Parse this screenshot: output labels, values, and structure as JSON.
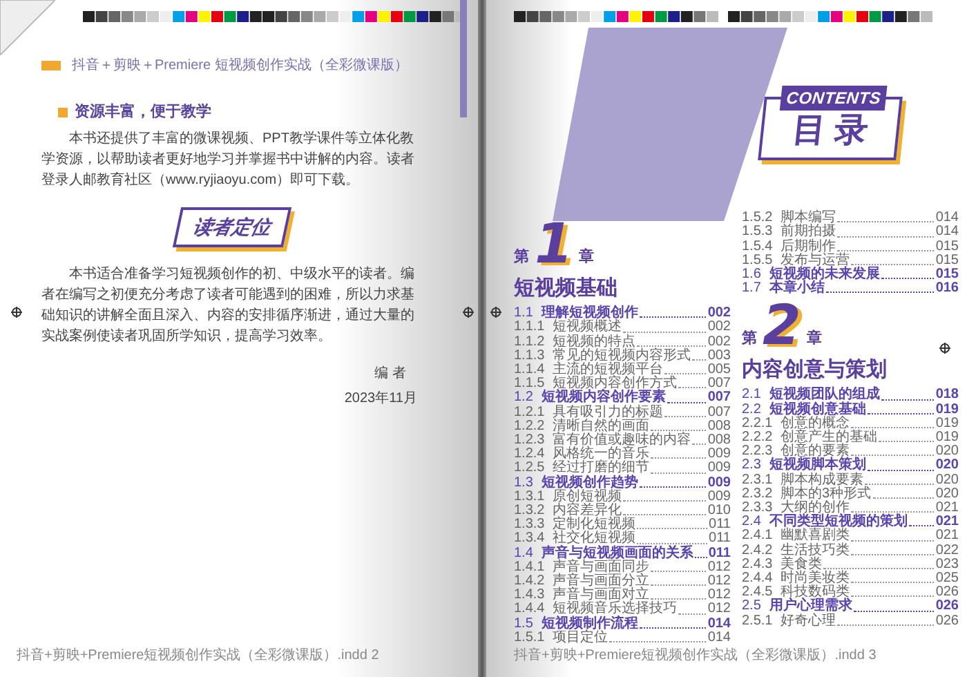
{
  "left_page": {
    "running_head": "抖音＋剪映＋Premiere 短视频创作实战（全彩微课版）",
    "section_heading": "资源丰富，便于教学",
    "section_text": "本书还提供了丰富的微课视频、PPT教学课件等立体化教学资源，以帮助读者更好地学习并掌握书中讲解的内容。读者登录人邮教育社区（www.ryjiaoyu.com）即可下载。",
    "badge": "读者定位",
    "body_text": "本书适合准备学习短视频创作的初、中级水平的读者。编者在编写之初便充分考虑了读者可能遇到的困难，所以力求基础知识的讲解全面且深入、内容的安排循序渐进，通过大量的实战案例使读者巩固所学知识，提高学习效率。",
    "signature": "编 者",
    "date": "2023年11月",
    "slug": "抖音+剪映+Premiere短视频创作实战（全彩微课版）.indd 2"
  },
  "right_page": {
    "contents_label": "CONTENTS",
    "contents_title": "目 录",
    "columns": [
      [
        {
          "kind": "chapter",
          "prefix": "第",
          "number": "1",
          "suffix": "章",
          "title": "短视频基础"
        },
        {
          "kind": "section",
          "number": "1.1",
          "title": "理解短视频创作",
          "page": "002"
        },
        {
          "kind": "subsection",
          "number": "1.1.1",
          "title": "短视频概述",
          "page": "002"
        },
        {
          "kind": "subsection",
          "number": "1.1.2",
          "title": "短视频的特点",
          "page": "002"
        },
        {
          "kind": "subsection",
          "number": "1.1.3",
          "title": "常见的短视频内容形式",
          "page": "003"
        },
        {
          "kind": "subsection",
          "number": "1.1.4",
          "title": "主流的短视频平台",
          "page": "005"
        },
        {
          "kind": "subsection",
          "number": "1.1.5",
          "title": "短视频内容创作方式",
          "page": "007"
        },
        {
          "kind": "section",
          "number": "1.2",
          "title": "短视频内容创作要素",
          "page": "007"
        },
        {
          "kind": "subsection",
          "number": "1.2.1",
          "title": "具有吸引力的标题",
          "page": "007"
        },
        {
          "kind": "subsection",
          "number": "1.2.2",
          "title": "清晰自然的画面",
          "page": "008"
        },
        {
          "kind": "subsection",
          "number": "1.2.3",
          "title": "富有价值或趣味的内容",
          "page": "008"
        },
        {
          "kind": "subsection",
          "number": "1.2.4",
          "title": "风格统一的音乐",
          "page": "009"
        },
        {
          "kind": "subsection",
          "number": "1.2.5",
          "title": "经过打磨的细节",
          "page": "009"
        },
        {
          "kind": "section",
          "number": "1.3",
          "title": "短视频创作趋势",
          "page": "009"
        },
        {
          "kind": "subsection",
          "number": "1.3.1",
          "title": "原创短视频",
          "page": "009"
        },
        {
          "kind": "subsection",
          "number": "1.3.2",
          "title": "内容差异化",
          "page": "010"
        },
        {
          "kind": "subsection",
          "number": "1.3.3",
          "title": "定制化短视频",
          "page": "011"
        },
        {
          "kind": "subsection",
          "number": "1.3.4",
          "title": "社交化短视频",
          "page": "011"
        },
        {
          "kind": "section",
          "number": "1.4",
          "title": "声音与短视频画面的关系",
          "page": "011"
        },
        {
          "kind": "subsection",
          "number": "1.4.1",
          "title": "声音与画面同步",
          "page": "012"
        },
        {
          "kind": "subsection",
          "number": "1.4.2",
          "title": "声音与画面分立",
          "page": "012"
        },
        {
          "kind": "subsection",
          "number": "1.4.3",
          "title": "声音与画面对立",
          "page": "012"
        },
        {
          "kind": "subsection",
          "number": "1.4.4",
          "title": "短视频音乐选择技巧",
          "page": "012"
        },
        {
          "kind": "section",
          "number": "1.5",
          "title": "短视频制作流程",
          "page": "014"
        },
        {
          "kind": "subsection",
          "number": "1.5.1",
          "title": "项目定位",
          "page": "014"
        }
      ],
      [
        {
          "kind": "subsection",
          "number": "1.5.2",
          "title": "脚本编写",
          "page": "014"
        },
        {
          "kind": "subsection",
          "number": "1.5.3",
          "title": "前期拍摄",
          "page": "014"
        },
        {
          "kind": "subsection",
          "number": "1.5.4",
          "title": "后期制作",
          "page": "015"
        },
        {
          "kind": "subsection",
          "number": "1.5.5",
          "title": "发布与运营",
          "page": "015"
        },
        {
          "kind": "section",
          "number": "1.6",
          "title": "短视频的未来发展",
          "page": "015"
        },
        {
          "kind": "section",
          "number": "1.7",
          "title": "本章小结",
          "page": "016"
        },
        {
          "kind": "chapter",
          "prefix": "第",
          "number": "2",
          "suffix": "章",
          "title": "内容创意与策划"
        },
        {
          "kind": "section",
          "number": "2.1",
          "title": "短视频团队的组成",
          "page": "018"
        },
        {
          "kind": "section",
          "number": "2.2",
          "title": "短视频创意基础",
          "page": "019"
        },
        {
          "kind": "subsection",
          "number": "2.2.1",
          "title": "创意的概念",
          "page": "019"
        },
        {
          "kind": "subsection",
          "number": "2.2.2",
          "title": "创意产生的基础",
          "page": "019"
        },
        {
          "kind": "subsection",
          "number": "2.2.3",
          "title": "创意的要素",
          "page": "020"
        },
        {
          "kind": "section",
          "number": "2.3",
          "title": "短视频脚本策划",
          "page": "020"
        },
        {
          "kind": "subsection",
          "number": "2.3.1",
          "title": "脚本构成要素",
          "page": "020"
        },
        {
          "kind": "subsection",
          "number": "2.3.2",
          "title": "脚本的3种形式",
          "page": "020"
        },
        {
          "kind": "subsection",
          "number": "2.3.3",
          "title": "大纲的创作",
          "page": "021"
        },
        {
          "kind": "section",
          "number": "2.4",
          "title": "不同类型短视频的策划",
          "page": "021"
        },
        {
          "kind": "subsection",
          "number": "2.4.1",
          "title": "幽默喜剧类",
          "page": "021"
        },
        {
          "kind": "subsection",
          "number": "2.4.2",
          "title": "生活技巧类",
          "page": "022"
        },
        {
          "kind": "subsection",
          "number": "2.4.3",
          "title": "美食类",
          "page": "023"
        },
        {
          "kind": "subsection",
          "number": "2.4.4",
          "title": "时尚美妆类",
          "page": "025"
        },
        {
          "kind": "subsection",
          "number": "2.4.5",
          "title": "科技数码类",
          "page": "026"
        },
        {
          "kind": "section",
          "number": "2.5",
          "title": "用户心理需求",
          "page": "026"
        },
        {
          "kind": "subsection",
          "number": "2.5.1",
          "title": "好奇心理",
          "page": "026"
        }
      ]
    ],
    "slug": "抖音+剪映+Premiere短视频创作实战（全彩微课版）.indd 3"
  }
}
